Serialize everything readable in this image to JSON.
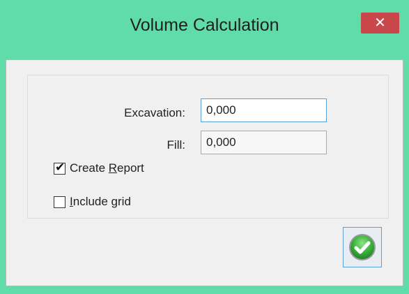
{
  "window": {
    "title": "Volume Calculation",
    "close_glyph": "✕"
  },
  "form": {
    "excavation": {
      "label": "Excavation:",
      "value": "0,000"
    },
    "fill": {
      "label": "Fill:",
      "value": "0,000"
    }
  },
  "options": {
    "create_report": {
      "label_prefix": "Create ",
      "mnemonic": "R",
      "label_suffix": "eport",
      "checked": true
    },
    "include_grid": {
      "label_prefix": "",
      "mnemonic": "I",
      "label_suffix": "nclude grid",
      "checked": false
    }
  },
  "icons": {
    "ok": "check-circle-icon",
    "close": "close-icon"
  },
  "colors": {
    "frame": "#5fdca8",
    "close_bg": "#c9474a",
    "ok_green": "#3bb23b",
    "focus_blue": "#5b9fd6"
  }
}
